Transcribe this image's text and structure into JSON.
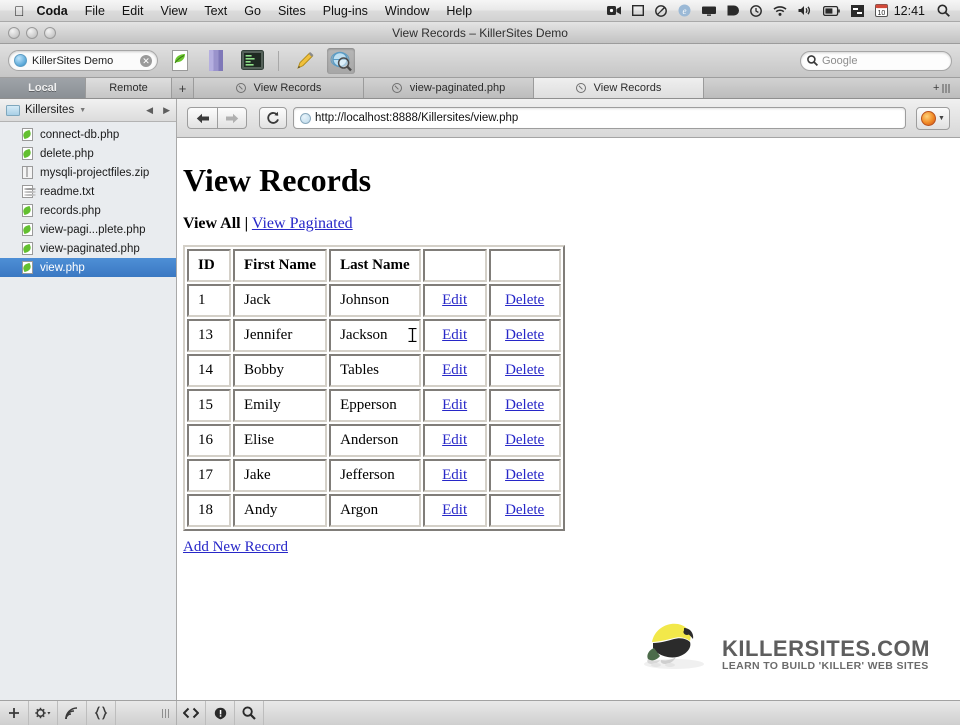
{
  "menubar": {
    "apple_icon": "apple-icon",
    "items": [
      {
        "label": "Coda",
        "bold": true
      },
      {
        "label": "File",
        "bold": false
      },
      {
        "label": "Edit",
        "bold": false
      },
      {
        "label": "View",
        "bold": false
      },
      {
        "label": "Text",
        "bold": false
      },
      {
        "label": "Go",
        "bold": false
      },
      {
        "label": "Sites",
        "bold": false
      },
      {
        "label": "Plug-ins",
        "bold": false
      },
      {
        "label": "Window",
        "bold": false
      },
      {
        "label": "Help",
        "bold": false
      }
    ],
    "status_icons": [
      "screen-recording-icon",
      "display-icon",
      "timemachine-icon",
      "internet-explorer-icon",
      "display-mirror-icon",
      "dropbox-icon",
      "clock-history-icon",
      "wifi-icon",
      "volume-icon",
      "battery-icon",
      "sync-icon",
      "calendar-icon"
    ],
    "clock": "12:41",
    "spotlight_icon": "search-icon"
  },
  "window": {
    "title": "View Records – KillerSites Demo",
    "traffic_lights": [
      "close-button",
      "minimize-button",
      "zoom-button"
    ]
  },
  "toolbar": {
    "site_name": "KillerSites Demo",
    "site_icon": "globe-icon",
    "clear_icon": "clear-icon",
    "buttons": [
      {
        "name": "new-file-button",
        "icon": "leaf-page-icon"
      },
      {
        "name": "books-button",
        "icon": "book-icon"
      },
      {
        "name": "terminal-button",
        "icon": "terminal-icon"
      },
      {
        "name": "edit-button",
        "icon": "pencil-icon"
      },
      {
        "name": "preview-button",
        "icon": "magnifier-globe-icon"
      }
    ],
    "search_placeholder": "Google",
    "search_icon": "search-icon"
  },
  "tabstrip": {
    "local_label": "Local",
    "remote_label": "Remote",
    "add_tab_label": "+",
    "tabs": [
      {
        "label": "View Records",
        "active": false
      },
      {
        "label": "view-paginated.php",
        "active": false
      },
      {
        "label": "View Records",
        "active": true
      }
    ],
    "right_add_label": "+",
    "right_list_icon": "tab-overview-icon"
  },
  "sidebar": {
    "folder_name": "Killersites",
    "folder_icon": "folder-icon",
    "disclosure_icon": "chevron-down-icon",
    "back_icon": "chevron-left-icon",
    "forward_icon": "chevron-right-icon",
    "files": [
      {
        "name": "connect-db.php",
        "type": "php",
        "selected": false
      },
      {
        "name": "delete.php",
        "type": "php",
        "selected": false
      },
      {
        "name": "mysqli-projectfiles.zip",
        "type": "zip",
        "selected": false
      },
      {
        "name": "readme.txt",
        "type": "txt",
        "selected": false
      },
      {
        "name": "records.php",
        "type": "php",
        "selected": false
      },
      {
        "name": "view-pagi...plete.php",
        "type": "php",
        "selected": false
      },
      {
        "name": "view-paginated.php",
        "type": "php",
        "selected": false
      },
      {
        "name": "view.php",
        "type": "php",
        "selected": true
      }
    ]
  },
  "browser": {
    "back_icon": "arrow-left-icon",
    "forward_icon": "arrow-right-icon",
    "reload_icon": "reload-icon",
    "url": "http://localhost:8888/Killersites/view.php",
    "url_icon": "globe-icon",
    "browser_icon": "firefox-icon",
    "browser_caret": "chevron-down-icon"
  },
  "page": {
    "title": "View Records",
    "nav": {
      "view_all": "View All",
      "separator": "|",
      "view_paginated": "View Paginated"
    },
    "table": {
      "headers": [
        "ID",
        "First Name",
        "Last Name",
        "",
        ""
      ],
      "rows": [
        {
          "id": "1",
          "first": "Jack",
          "last": "Johnson",
          "edit": "Edit",
          "delete": "Delete"
        },
        {
          "id": "13",
          "first": "Jennifer",
          "last": "Jackson",
          "edit": "Edit",
          "delete": "Delete"
        },
        {
          "id": "14",
          "first": "Bobby",
          "last": "Tables",
          "edit": "Edit",
          "delete": "Delete"
        },
        {
          "id": "15",
          "first": "Emily",
          "last": "Epperson",
          "edit": "Edit",
          "delete": "Delete"
        },
        {
          "id": "16",
          "first": "Elise",
          "last": "Anderson",
          "edit": "Edit",
          "delete": "Delete"
        },
        {
          "id": "17",
          "first": "Jake",
          "last": "Jefferson",
          "edit": "Edit",
          "delete": "Delete"
        },
        {
          "id": "18",
          "first": "Andy",
          "last": "Argon",
          "edit": "Edit",
          "delete": "Delete"
        }
      ]
    },
    "add_new_record": "Add New Record",
    "logo": {
      "icon": "frog-icon",
      "title": "KILLERSITES.COM",
      "tagline": "LEARN TO BUILD 'KILLER' WEB SITES"
    },
    "link_color": "#2727c8"
  },
  "statusbar": {
    "left_buttons": [
      {
        "name": "add-file-button",
        "icon": "plus-icon"
      },
      {
        "name": "actions-button",
        "icon": "gear-icon"
      },
      {
        "name": "publish-button",
        "icon": "broadcast-icon"
      },
      {
        "name": "code-braces-button",
        "icon": "braces-icon"
      }
    ],
    "resize_icon": "grip-icon",
    "right_buttons": [
      {
        "name": "source-view-button",
        "icon": "angle-brackets-icon"
      },
      {
        "name": "validate-button",
        "icon": "info-icon"
      },
      {
        "name": "find-button",
        "icon": "search-icon"
      }
    ]
  }
}
